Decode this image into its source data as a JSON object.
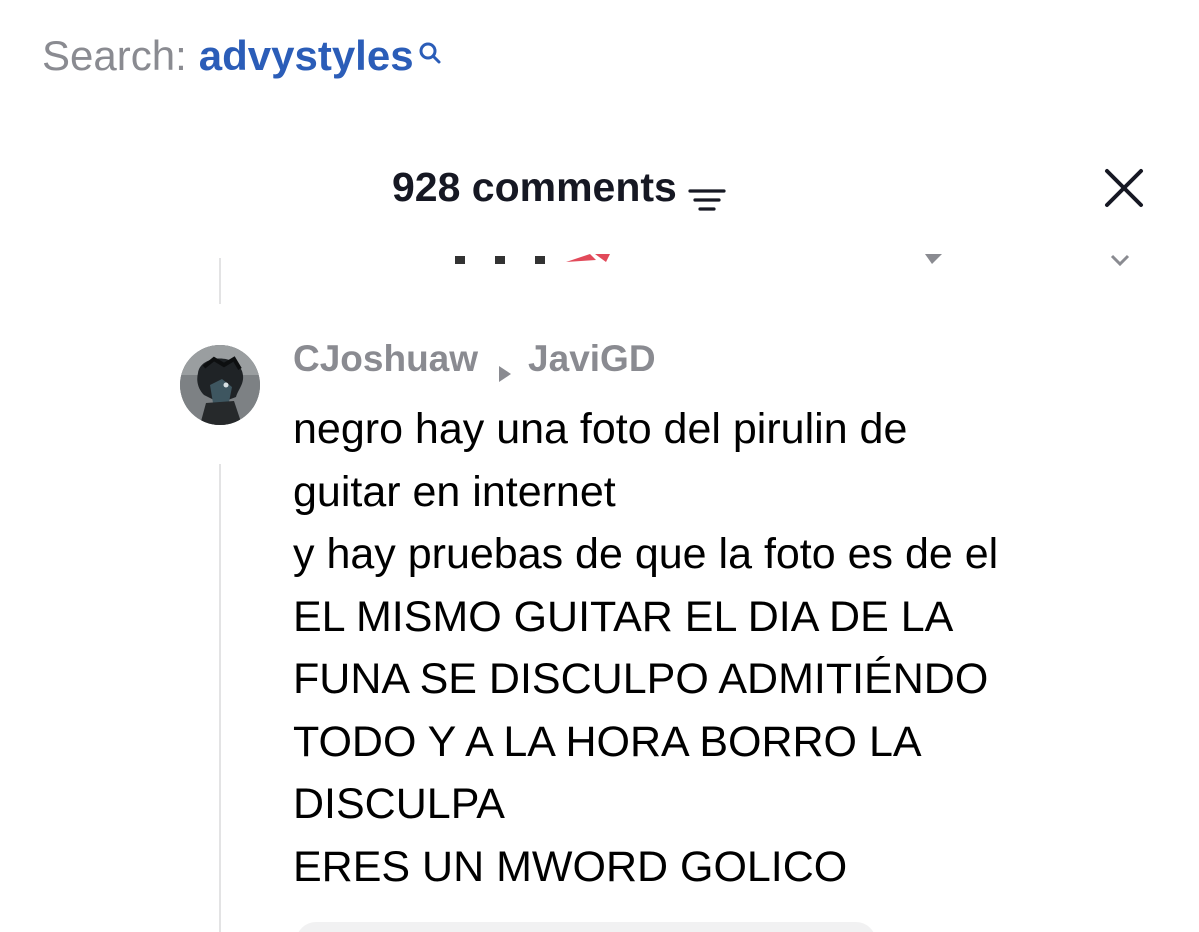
{
  "search": {
    "label": "Search:",
    "term": "advystyles"
  },
  "comments": {
    "title": "928 comments"
  },
  "reply": {
    "author": "CJoshuaw",
    "reply_to": "JaviGD",
    "lines": [
      "negro hay una foto del pirulin de",
      "guitar en internet",
      "y hay pruebas de que la foto es de el",
      "EL MISMO GUITAR EL DIA DE LA",
      "FUNA SE DISCULPO ADMITIÉNDO",
      "TODO Y A LA HORA BORRO LA",
      "DISCULPA",
      "ERES UN MWORD GOLICO"
    ]
  },
  "colors": {
    "search_label": "#8a8b91",
    "search_term": "#2b5db8",
    "text_primary": "#161823",
    "text_secondary": "#8a8b91",
    "thread_line": "#e3e3e4"
  },
  "icons": {
    "search": "search-icon",
    "sort": "sort-filter-icon",
    "close": "close-icon",
    "reply_arrow": "reply-arrow-icon"
  }
}
